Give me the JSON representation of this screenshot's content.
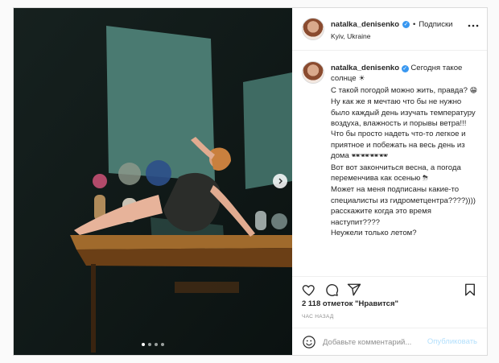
{
  "post": {
    "username": "natalka_denisenko",
    "follow_label": "Подписки",
    "separator": "•",
    "location": "Kyiv, Ukraine",
    "verified_glyph": "✓"
  },
  "caption": {
    "lines": [
      "Сегодня такое солнце",
      "С такой погодой можно жить, правда?",
      "Ну как же я мечтаю что бы не нужно было каждый день изучать температуру воздуха, влажность и порывы ветра!!! Что бы просто надеть что-то легкое и приятное и побежать на весь день из дома",
      "Вот вот закончиться весна, а погода переменчива как осенью",
      "Может на меня подписаны какие-то специалисты из гидрометцентра????)))) расскажите когда это время наступит????",
      "Неужели только летом?"
    ],
    "emoji": {
      "sun": "☀",
      "grin": "😁",
      "sunglasses": "🕶🕶🕶🕶",
      "storm": "⛈"
    }
  },
  "engagement": {
    "likes": "2 118 отметок \"Нравится\"",
    "time": "ЧАС НАЗАД"
  },
  "comment": {
    "placeholder": "Добавьте комментарий...",
    "publish_label": "Опубликовать"
  },
  "carousel": {
    "slides": 4,
    "active": 0
  },
  "colors": {
    "link": "#3897f0",
    "publish_disabled": "#b2dffc",
    "wall": "#3f6b63"
  },
  "icons": [
    "heart-icon",
    "comment-icon",
    "share-icon",
    "bookmark-icon",
    "smile-icon",
    "chevron-right-icon",
    "verified-icon"
  ]
}
